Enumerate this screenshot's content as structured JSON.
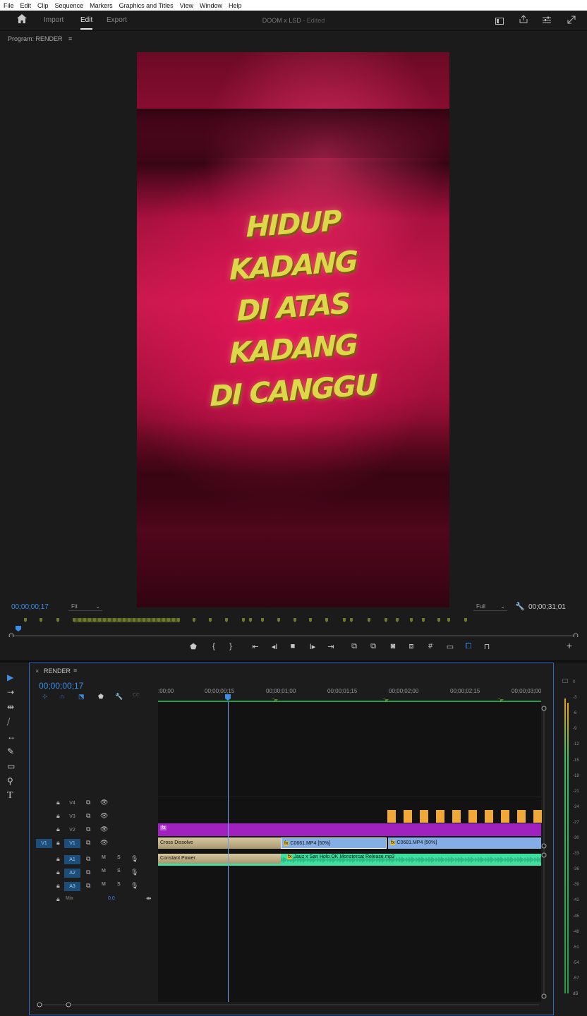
{
  "menu": [
    "File",
    "Edit",
    "Clip",
    "Sequence",
    "Markers",
    "Graphics and Titles",
    "View",
    "Window",
    "Help"
  ],
  "header": {
    "tabs": [
      "Import",
      "Edit",
      "Export"
    ],
    "active_tab": "Edit",
    "doc_title": "DOOM x LSD",
    "doc_status": "- Edited"
  },
  "program": {
    "title": "Program: RENDER",
    "menu_icon": "≡",
    "overlay_lines": [
      "HIDUP",
      "KADANG",
      "DI ATAS",
      "KADANG",
      "DI CANGGU"
    ],
    "timecode_current": "00;00;00;17",
    "fit": "Fit",
    "quality": "Full",
    "timecode_duration": "00;00;31;01"
  },
  "controls": [
    "marker-icon",
    "mark-in-icon",
    "mark-out-icon",
    "go-to-in-icon",
    "step-back-icon",
    "stop-icon",
    "play-icon",
    "go-to-out-icon",
    "lift-icon",
    "extract-icon",
    "export-frame-icon",
    "comparison-view-icon",
    "safe-margins-icon",
    "proxy-icon",
    "vr-icon",
    "trim-icon",
    "add-button-icon"
  ],
  "timeline": {
    "tab_close": "×",
    "sequence_name": "RENDER",
    "menu_icon": "≡",
    "timecode": "00;00;00;17",
    "ruler_labels": [
      ":00;00",
      "00;00;00;15",
      "00;00;01;00",
      "00;00;01;15",
      "00;00;02;00",
      "00;00;02;15",
      "00;00;03;00"
    ],
    "tracks": {
      "v4": "V4",
      "v3": "V3",
      "v2": "V2",
      "v1": "V1",
      "source_v1": "V1",
      "a1": "A1",
      "a2": "A2",
      "a3": "A3",
      "mix_label": "Mix",
      "mix_value": "0.0"
    },
    "track_toggles": {
      "mute": "M",
      "solo": "S"
    },
    "clips": {
      "transition": "Cross Dissolve",
      "v1_clip_1": "C0661.MP4 [50%]",
      "v1_clip_2": "C0681.MP4 [50%]",
      "audio_transition": "Constant Power",
      "audio_clip": "Jauz x San Holo  OK Monstercat Release.mp3",
      "fx": "fx"
    }
  },
  "meter": {
    "labels": [
      "0",
      "-3",
      "-6",
      "-9",
      "-12",
      "-15",
      "-18",
      "-21",
      "-24",
      "-27",
      "-30",
      "-33",
      "-36",
      "-39",
      "-42",
      "-45",
      "-48",
      "-51",
      "-54",
      "-57",
      "dB"
    ]
  },
  "colors": {
    "accent": "#3b8de6",
    "v2_clip": "#a020c0",
    "v1_clip": "#86aee6",
    "audio_clip": "#3de0a0",
    "title_clip": "#f0a838",
    "marker": "#6a7a2a"
  }
}
